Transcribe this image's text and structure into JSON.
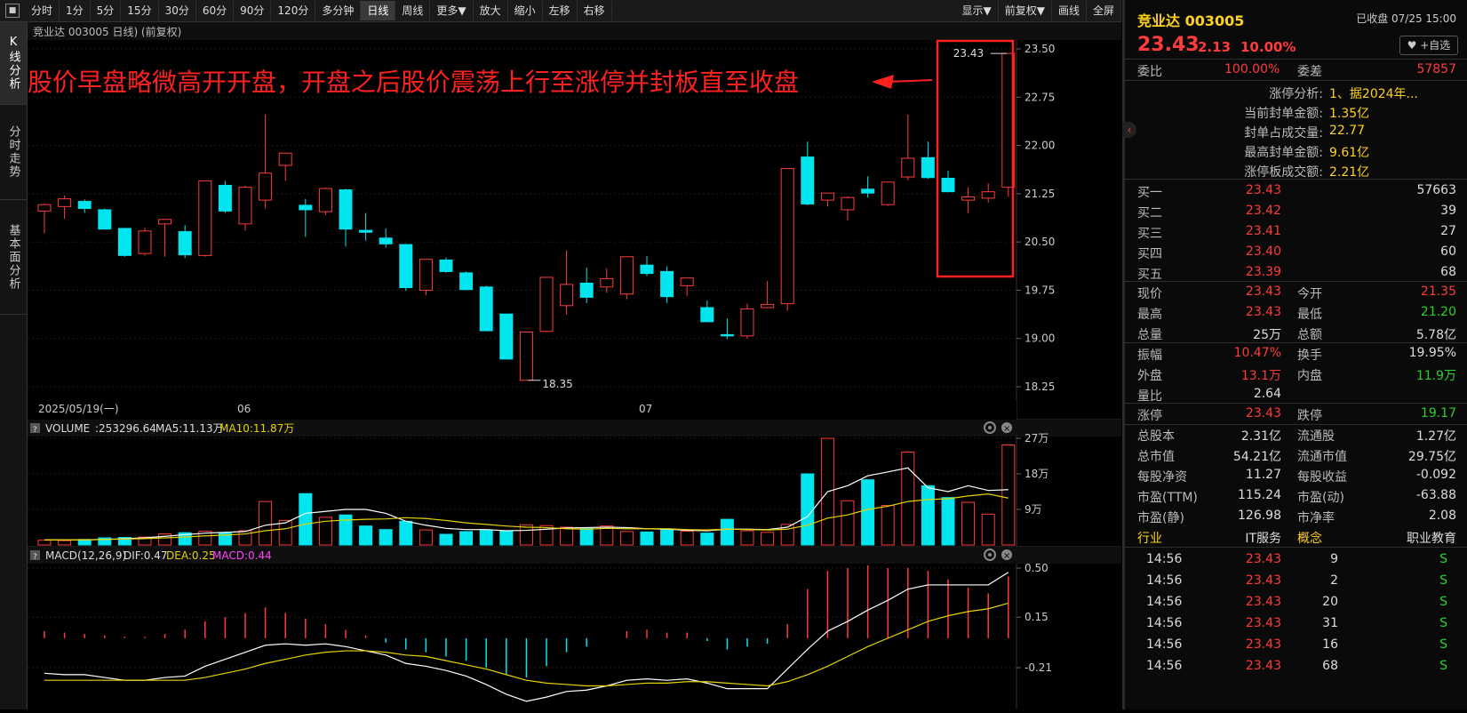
{
  "toolbar": {
    "left_icon": "■",
    "periods": [
      "分时",
      "1分",
      "5分",
      "15分",
      "30分",
      "60分",
      "90分",
      "120分",
      "多分钟",
      "日线",
      "周线",
      "更多▼"
    ],
    "active_period": "日线",
    "actions": [
      "放大",
      "缩小",
      "左移",
      "右移"
    ],
    "right": [
      "显示▼",
      "前复权▼",
      "画线",
      "全屏"
    ]
  },
  "leftbar": {
    "tabs": [
      "K线分析",
      "分时走势",
      "基本面分析"
    ]
  },
  "kline": {
    "title": "竞业达 003005 日线) (前复权)",
    "annotation": "股价早盘略微高开开盘，开盘之后股价震荡上行至涨停并封板直至收盘",
    "high_label": "23.43",
    "low_label": "18.35",
    "date_labels": [
      "2025/05/19(一)",
      "06",
      "07"
    ],
    "y_labels": [
      "23.50",
      "22.75",
      "22.00",
      "21.25",
      "20.50",
      "19.75",
      "19.00",
      "18.25"
    ]
  },
  "volume": {
    "label": "VOLUME",
    "value": ":253296.64",
    "ma5": "MA5:11.13万",
    "ma10": "MA10:11.87万",
    "y_labels": [
      "27万",
      "18万",
      "9万"
    ]
  },
  "macd": {
    "label": "MACD(12,26,9)",
    "dif": "DIF:0.47",
    "dea": "DEA:0.25",
    "macd": "MACD:0.44",
    "y_labels": [
      "0.50",
      "0.15",
      "-0.21"
    ]
  },
  "colors": {
    "up": "#ff3b3b",
    "down": "#00e5ee",
    "ma5": "#ffffff",
    "ma10": "#e6d200",
    "annotation": "#ff2020"
  },
  "chart_data": {
    "type": "candlestick",
    "ohlc": [
      [
        20.98,
        21.1,
        20.63,
        21.08
      ],
      [
        21.05,
        21.22,
        20.86,
        21.17
      ],
      [
        21.13,
        21.16,
        20.95,
        21.02
      ],
      [
        21.0,
        21.02,
        20.69,
        20.7
      ],
      [
        20.71,
        20.71,
        20.27,
        20.29
      ],
      [
        20.32,
        20.72,
        20.29,
        20.67
      ],
      [
        20.78,
        20.84,
        20.27,
        20.85
      ],
      [
        20.66,
        20.76,
        20.25,
        20.3
      ],
      [
        20.29,
        21.45,
        20.27,
        21.45
      ],
      [
        21.38,
        21.45,
        20.95,
        20.98
      ],
      [
        20.78,
        21.37,
        20.68,
        21.35
      ],
      [
        21.15,
        22.48,
        21.02,
        21.57
      ],
      [
        21.69,
        21.89,
        21.45,
        21.88
      ],
      [
        21.07,
        21.17,
        20.58,
        21.0
      ],
      [
        20.97,
        21.35,
        20.92,
        21.33
      ],
      [
        21.31,
        21.33,
        20.43,
        20.7
      ],
      [
        20.68,
        20.95,
        20.52,
        20.65
      ],
      [
        20.56,
        20.71,
        20.41,
        20.47
      ],
      [
        20.46,
        20.47,
        19.74,
        19.79
      ],
      [
        19.75,
        20.23,
        19.67,
        20.23
      ],
      [
        20.22,
        20.26,
        20.02,
        20.04
      ],
      [
        20.02,
        20.04,
        19.75,
        19.76
      ],
      [
        19.8,
        19.82,
        19.11,
        19.12
      ],
      [
        19.38,
        19.38,
        18.68,
        18.68
      ],
      [
        18.35,
        19.1,
        18.35,
        19.1
      ],
      [
        19.11,
        19.95,
        19.1,
        19.95
      ],
      [
        19.51,
        20.37,
        19.37,
        19.84
      ],
      [
        19.86,
        20.1,
        19.55,
        19.64
      ],
      [
        19.8,
        20.09,
        19.71,
        19.93
      ],
      [
        19.69,
        20.27,
        19.61,
        20.27
      ],
      [
        20.14,
        20.28,
        19.97,
        20.01
      ],
      [
        20.04,
        20.12,
        19.55,
        19.65
      ],
      [
        19.82,
        19.94,
        19.66,
        19.94
      ],
      [
        19.48,
        19.59,
        19.26,
        19.26
      ],
      [
        19.06,
        19.31,
        18.99,
        19.04
      ],
      [
        19.04,
        19.54,
        19.0,
        19.46
      ],
      [
        19.48,
        19.89,
        19.47,
        19.53
      ],
      [
        19.54,
        21.64,
        19.43,
        21.64
      ],
      [
        21.82,
        22.06,
        21.07,
        21.09
      ],
      [
        21.15,
        21.26,
        21.05,
        21.26
      ],
      [
        21.0,
        21.21,
        20.83,
        21.19
      ],
      [
        21.32,
        21.52,
        21.19,
        21.26
      ],
      [
        21.08,
        21.4,
        21.06,
        21.43
      ],
      [
        21.51,
        22.48,
        21.46,
        21.8
      ],
      [
        21.81,
        22.06,
        21.48,
        21.5
      ],
      [
        21.49,
        21.61,
        21.28,
        21.28
      ],
      [
        21.15,
        21.35,
        20.95,
        21.2
      ],
      [
        21.18,
        21.41,
        21.11,
        21.28
      ],
      [
        21.35,
        23.43,
        21.2,
        23.43
      ]
    ],
    "volume": [
      1.2,
      1.1,
      1.4,
      1.8,
      1.9,
      2.0,
      2.8,
      3.1,
      3.5,
      3.0,
      3.6,
      11.0,
      6.2,
      13.0,
      7.0,
      7.6,
      4.8,
      3.9,
      6.0,
      3.8,
      2.7,
      3.4,
      3.8,
      3.6,
      5.1,
      4.9,
      4.5,
      4.2,
      4.8,
      3.4,
      3.3,
      4.0,
      3.5,
      3.0,
      6.5,
      3.6,
      3.2,
      5.2,
      18.0,
      36.5,
      11.2,
      16.5,
      10.0,
      23.5,
      15.0,
      12.0,
      10.8,
      7.8,
      25.3
    ],
    "volume_ma5": [
      1.3,
      1.3,
      1.3,
      1.4,
      1.6,
      1.8,
      2.2,
      2.6,
      3.0,
      3.2,
      3.4,
      5.0,
      5.6,
      8.0,
      8.5,
      9.0,
      9.0,
      8.0,
      6.0,
      5.0,
      4.2,
      3.9,
      3.9,
      3.6,
      3.7,
      4.0,
      4.3,
      4.4,
      4.5,
      4.4,
      4.1,
      4.0,
      3.7,
      3.6,
      4.0,
      4.0,
      3.9,
      4.5,
      7.2,
      13.5,
      15.0,
      17.5,
      18.5,
      19.5,
      14.5,
      13.5,
      15.0,
      13.8,
      14.0
    ],
    "volume_ma10": [
      1.3,
      1.3,
      1.3,
      1.4,
      1.5,
      1.6,
      1.8,
      2.0,
      2.3,
      2.5,
      2.8,
      3.6,
      4.1,
      5.3,
      6.0,
      6.3,
      6.5,
      6.6,
      6.9,
      6.7,
      6.2,
      5.6,
      5.2,
      4.8,
      4.5,
      4.4,
      4.1,
      4.0,
      4.2,
      4.1,
      4.1,
      4.1,
      3.9,
      3.8,
      4.0,
      3.9,
      3.8,
      4.0,
      5.0,
      6.8,
      7.6,
      9.0,
      9.8,
      11.0,
      11.5,
      11.7,
      12.4,
      12.9,
      11.87
    ],
    "macd_dif": [
      -0.25,
      -0.26,
      -0.26,
      -0.28,
      -0.3,
      -0.3,
      -0.28,
      -0.27,
      -0.2,
      -0.15,
      -0.1,
      -0.05,
      -0.04,
      -0.05,
      -0.04,
      -0.06,
      -0.09,
      -0.12,
      -0.18,
      -0.2,
      -0.23,
      -0.27,
      -0.33,
      -0.4,
      -0.45,
      -0.42,
      -0.38,
      -0.37,
      -0.34,
      -0.3,
      -0.29,
      -0.3,
      -0.29,
      -0.32,
      -0.36,
      -0.36,
      -0.36,
      -0.22,
      -0.08,
      0.05,
      0.12,
      0.2,
      0.27,
      0.35,
      0.38,
      0.38,
      0.38,
      0.38,
      0.47
    ],
    "macd_dea": [
      -0.3,
      -0.3,
      -0.3,
      -0.3,
      -0.3,
      -0.3,
      -0.3,
      -0.3,
      -0.28,
      -0.25,
      -0.22,
      -0.18,
      -0.15,
      -0.12,
      -0.1,
      -0.09,
      -0.09,
      -0.1,
      -0.12,
      -0.13,
      -0.16,
      -0.19,
      -0.22,
      -0.26,
      -0.3,
      -0.32,
      -0.33,
      -0.34,
      -0.34,
      -0.33,
      -0.32,
      -0.32,
      -0.31,
      -0.31,
      -0.32,
      -0.33,
      -0.34,
      -0.31,
      -0.26,
      -0.2,
      -0.13,
      -0.06,
      0.0,
      0.06,
      0.12,
      0.16,
      0.19,
      0.21,
      0.25
    ],
    "macd_hist": [
      0.05,
      0.04,
      0.03,
      0.02,
      0.01,
      0.01,
      0.03,
      0.06,
      0.12,
      0.15,
      0.18,
      0.22,
      0.18,
      0.14,
      0.1,
      0.06,
      0.02,
      -0.03,
      -0.08,
      -0.1,
      -0.13,
      -0.16,
      -0.21,
      -0.26,
      -0.28,
      -0.2,
      -0.1,
      -0.06,
      0.0,
      0.05,
      0.06,
      0.04,
      0.04,
      -0.02,
      -0.08,
      -0.06,
      -0.04,
      0.1,
      0.35,
      0.48,
      0.5,
      0.52,
      0.5,
      0.5,
      0.48,
      0.42,
      0.36,
      0.32,
      0.44
    ],
    "price_axis": [
      18.25,
      23.5
    ],
    "volume_axis": [
      0,
      27
    ],
    "macd_axis": [
      -0.21,
      0.5
    ]
  },
  "panel": {
    "name": "竞业达 003005",
    "status": "已收盘 07/25 15:00",
    "price": "23.43",
    "change": "2.13",
    "pct": "10.00%",
    "watch": "♥ +自选",
    "webi_label": "委比",
    "webi": "100.00%",
    "weicha_label": "委差",
    "weicha": "57857",
    "limit_info": [
      {
        "label": "涨停分析:",
        "value": "1、据2024年..."
      },
      {
        "label": "当前封单金额:",
        "value": "1.35亿"
      },
      {
        "label": "封单占成交量:",
        "value": "22.77"
      },
      {
        "label": "最高封单金额:",
        "value": "9.61亿"
      },
      {
        "label": "涨停板成交额:",
        "value": "2.21亿"
      }
    ],
    "bids": [
      {
        "label": "买一",
        "price": "23.43",
        "vol": "57663"
      },
      {
        "label": "买二",
        "price": "23.42",
        "vol": "39"
      },
      {
        "label": "买三",
        "price": "23.41",
        "vol": "27"
      },
      {
        "label": "买四",
        "price": "23.40",
        "vol": "60"
      },
      {
        "label": "买五",
        "price": "23.39",
        "vol": "68"
      }
    ],
    "quote": [
      {
        "l1": "现价",
        "v1": "23.43",
        "c1": "red",
        "l2": "今开",
        "v2": "21.35",
        "c2": "red"
      },
      {
        "l1": "最高",
        "v1": "23.43",
        "c1": "red",
        "l2": "最低",
        "v2": "21.20",
        "c2": "green"
      },
      {
        "l1": "总量",
        "v1": "25万",
        "c1": "white",
        "l2": "总额",
        "v2": "5.78亿",
        "c2": "white"
      }
    ],
    "stats": [
      {
        "l1": "振幅",
        "v1": "10.47%",
        "c1": "red",
        "l2": "换手",
        "v2": "19.95%",
        "c2": "white"
      },
      {
        "l1": "外盘",
        "v1": "13.1万",
        "c1": "red",
        "l2": "内盘",
        "v2": "11.9万",
        "c2": "green"
      },
      {
        "l1": "量比",
        "v1": "2.64",
        "c1": "white",
        "l2": "",
        "v2": "",
        "c2": "white"
      }
    ],
    "limit": {
      "l1": "涨停",
      "v1": "23.43",
      "l2": "跌停",
      "v2": "19.17"
    },
    "fundamentals": [
      {
        "l1": "总股本",
        "v1": "2.31亿",
        "l2": "流通股",
        "v2": "1.27亿"
      },
      {
        "l1": "总市值",
        "v1": "54.21亿",
        "l2": "流通市值",
        "v2": "29.75亿"
      },
      {
        "l1": "每股净资",
        "v1": "11.27",
        "l2": "每股收益",
        "v2": "-0.092"
      },
      {
        "l1": "市盈(TTM)",
        "v1": "115.24",
        "l2": "市盈(动)",
        "v2": "-63.88"
      },
      {
        "l1": "市盈(静)",
        "v1": "126.98",
        "l2": "市净率",
        "v2": "2.08"
      }
    ],
    "industry": {
      "l1": "行业",
      "v1": "IT服务",
      "l2": "概念",
      "v2": "职业教育"
    },
    "ticks": [
      {
        "time": "14:56",
        "price": "23.43",
        "vol": "9",
        "side": "S"
      },
      {
        "time": "14:56",
        "price": "23.43",
        "vol": "2",
        "side": "S"
      },
      {
        "time": "14:56",
        "price": "23.43",
        "vol": "20",
        "side": "S"
      },
      {
        "time": "14:56",
        "price": "23.43",
        "vol": "31",
        "side": "S"
      },
      {
        "time": "14:56",
        "price": "23.43",
        "vol": "16",
        "side": "S"
      },
      {
        "time": "14:56",
        "price": "23.43",
        "vol": "68",
        "side": "S"
      }
    ]
  }
}
